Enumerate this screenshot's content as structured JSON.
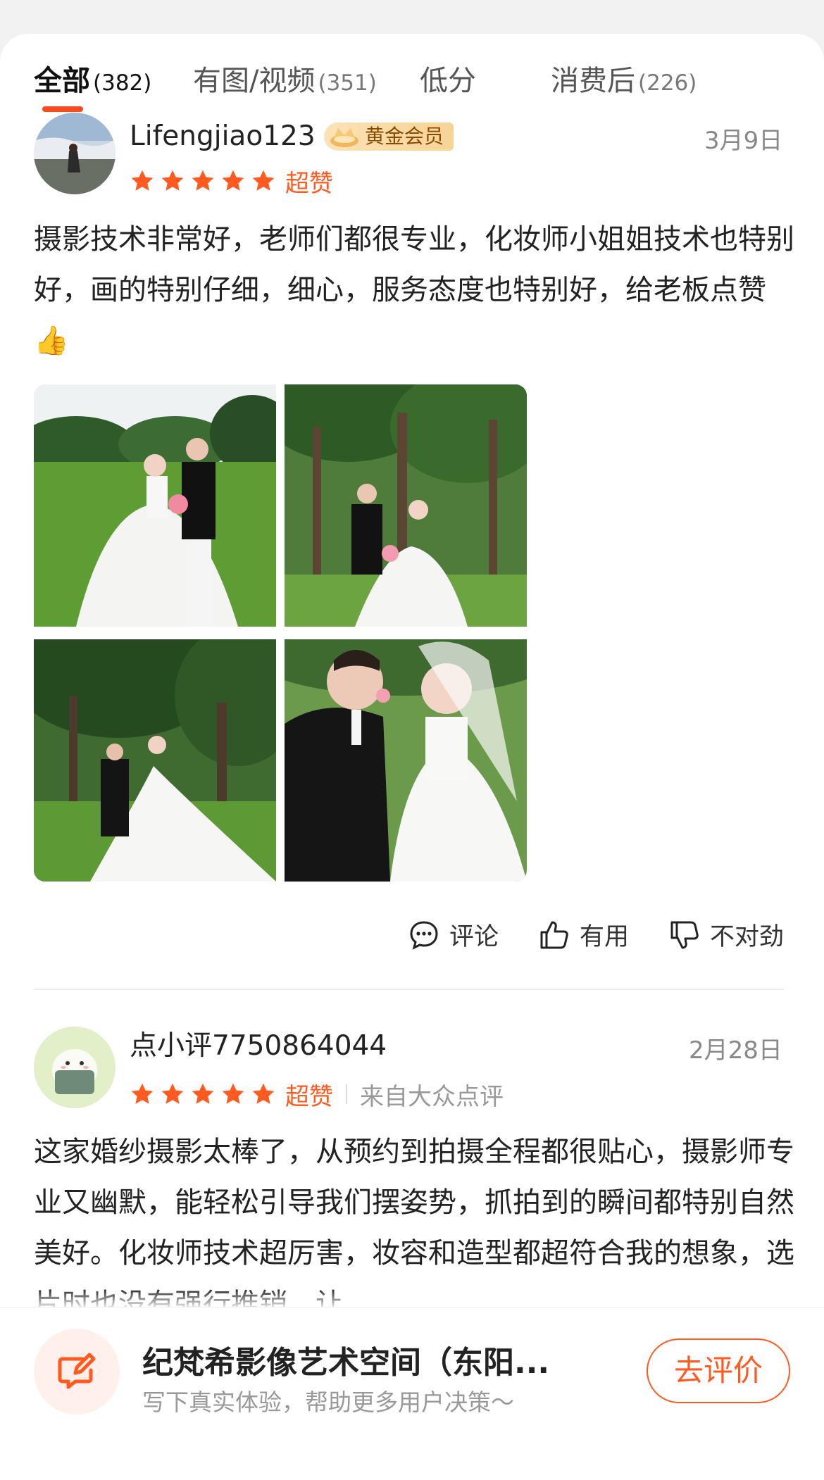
{
  "tabs": [
    {
      "label": "全部",
      "count": "(382)"
    },
    {
      "label": "有图/视频",
      "count": "(351)"
    },
    {
      "label": "低分",
      "count": ""
    },
    {
      "label": "消费后",
      "count": "(226)"
    }
  ],
  "reviews": [
    {
      "username": "Lifengjiao123",
      "badge": "黄金会员",
      "date": "3月9日",
      "rating_text": "超赞",
      "stars": 5,
      "source": "",
      "text": "摄影技术非常好，老师们都很专业，化妆师小姐姐技术也特别好，画的特别仔细，细心，服务态度也特别好，给老板点赞",
      "emoji": "👍"
    },
    {
      "username": "点小评7750864044",
      "badge": "",
      "date": "2月28日",
      "rating_text": "超赞",
      "stars": 5,
      "source": "来自大众点评",
      "text": "这家婚纱摄影太棒了，从预约到拍摄全程都很贴心，摄影师专业又幽默，能轻松引导我们摆姿势，抓拍到的瞬间都特别自然美好。化妆师技术超厉害，妆容和造型都超符合我的想象，选片时也没有强行推销，让"
    }
  ],
  "actions": {
    "comment": "评论",
    "useful": "有用",
    "wrong": "不对劲"
  },
  "bottom": {
    "shop_name": "纪梵希影像艺术空间（东阳...",
    "subtitle": "写下真实体验，帮助更多用户决策～",
    "button": "去评价"
  },
  "colors": {
    "accent": "#ff5a1f",
    "tab_indicator": "#ff4a1a",
    "badge_gold": "#f7d397"
  }
}
